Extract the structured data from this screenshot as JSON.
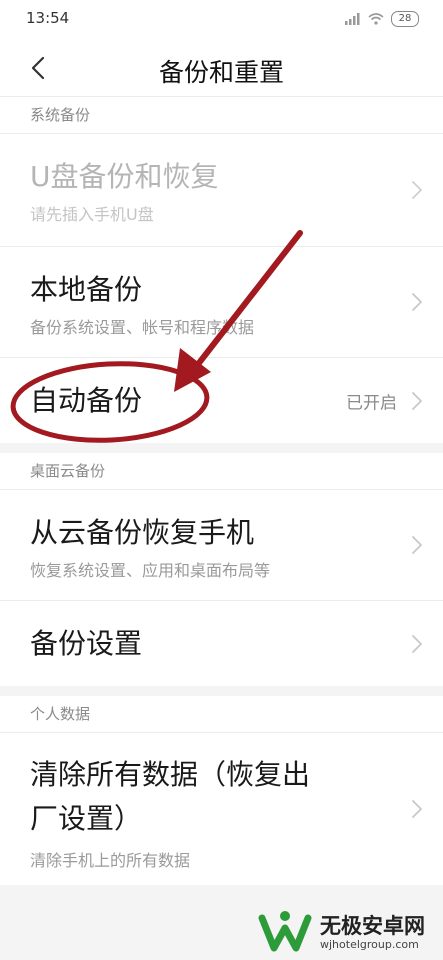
{
  "status_bar": {
    "time": "13:54",
    "battery": "28"
  },
  "header": {
    "title": "备份和重置"
  },
  "sections": {
    "system": {
      "header": "系统备份",
      "usb": {
        "title": "U盘备份和恢复",
        "subtitle": "请先插入手机U盘"
      },
      "local": {
        "title": "本地备份",
        "subtitle": "备份系统设置、帐号和程序数据"
      },
      "auto": {
        "title": "自动备份",
        "value": "已开启"
      }
    },
    "cloud": {
      "header": "桌面云备份",
      "restore": {
        "title": "从云备份恢复手机",
        "subtitle": "恢复系统设置、应用和桌面布局等"
      },
      "settings": {
        "title": "备份设置"
      }
    },
    "personal": {
      "header": "个人数据",
      "erase": {
        "title_line1": "清除所有数据（恢复出",
        "title_line2": "厂设置）",
        "subtitle": "清除手机上的所有数据"
      }
    }
  },
  "watermark": {
    "brand": "无极安卓网",
    "url": "wjhotelgroup.com"
  },
  "colors": {
    "annotation": "#a2191f",
    "disabled_text": "#b5b5b5",
    "secondary_text": "#9a9a9a",
    "divider": "#ececec"
  }
}
